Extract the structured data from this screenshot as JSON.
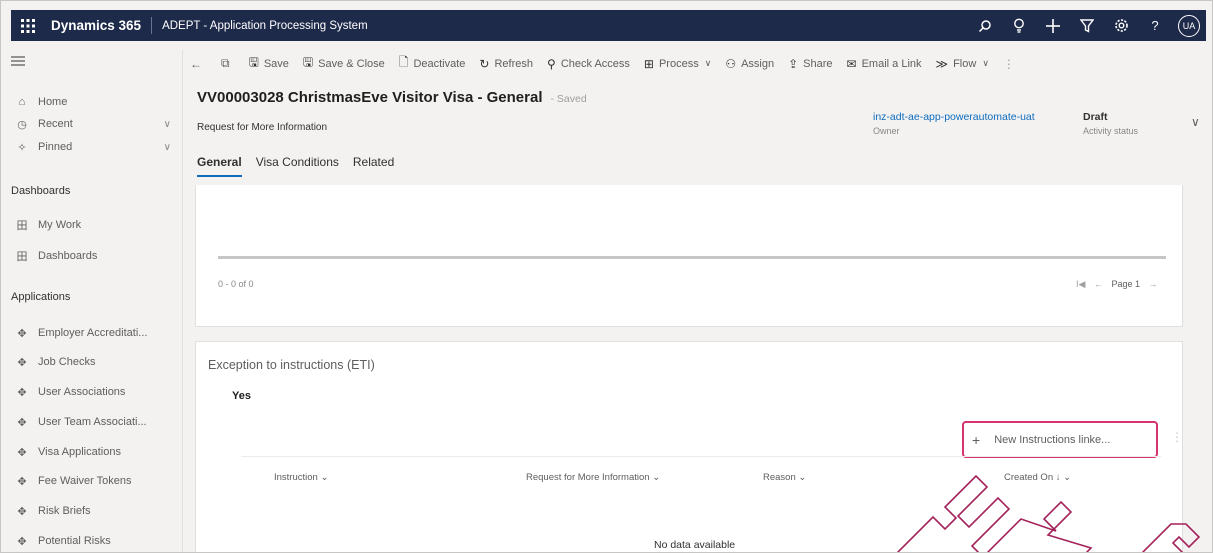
{
  "topbar": {
    "waffle_icon": "waffle-icon",
    "brand": "Dynamics 365",
    "app_title": "ADEPT - Application Processing System",
    "icons": [
      "search-icon",
      "lightbulb-icon",
      "plus-icon",
      "filter-icon",
      "gear-icon",
      "help-icon"
    ],
    "avatar_initials": "UA"
  },
  "sidebar": {
    "items_top": [
      {
        "label": "Home",
        "icon": "home-icon"
      },
      {
        "label": "Recent",
        "icon": "clock-icon"
      },
      {
        "label": "Pinned",
        "icon": "pin-icon"
      }
    ],
    "dashboards_heading": "Dashboards",
    "dashboards": [
      {
        "label": "My Work",
        "icon": "grid-icon"
      },
      {
        "label": "Dashboards",
        "icon": "grid-icon"
      }
    ],
    "applications_heading": "Applications",
    "applications": [
      {
        "label": "Employer Accreditati..."
      },
      {
        "label": "Job Checks"
      },
      {
        "label": "User Associations"
      },
      {
        "label": "User Team Associati..."
      },
      {
        "label": "Visa Applications"
      },
      {
        "label": "Fee Waiver Tokens"
      },
      {
        "label": "Risk Briefs"
      },
      {
        "label": "Potential Risks"
      }
    ]
  },
  "commands": {
    "save": "Save",
    "save_close": "Save & Close",
    "deactivate": "Deactivate",
    "refresh": "Refresh",
    "check_access": "Check Access",
    "process": "Process",
    "assign": "Assign",
    "share": "Share",
    "email_link": "Email a Link",
    "flow": "Flow"
  },
  "record": {
    "title": "VV00003028 ChristmasEve Visitor Visa - General",
    "saved": "- Saved",
    "subtitle": "Request for More Information",
    "owner_value": "inz-adt-ae-app-powerautomate-uat",
    "owner_label": "Owner",
    "status_value": "Draft",
    "status_label": "Activity status"
  },
  "tabs": [
    "General",
    "Visa Conditions",
    "Related"
  ],
  "grid_top": {
    "range": "0 - 0 of 0",
    "page": "Page 1"
  },
  "eti": {
    "title": "Exception to instructions (ETI)",
    "value": "Yes",
    "new_button": "New Instructions linke...",
    "columns": [
      "Instruction",
      "Request for More Information",
      "Reason",
      "Created On"
    ],
    "empty": "No data available"
  }
}
